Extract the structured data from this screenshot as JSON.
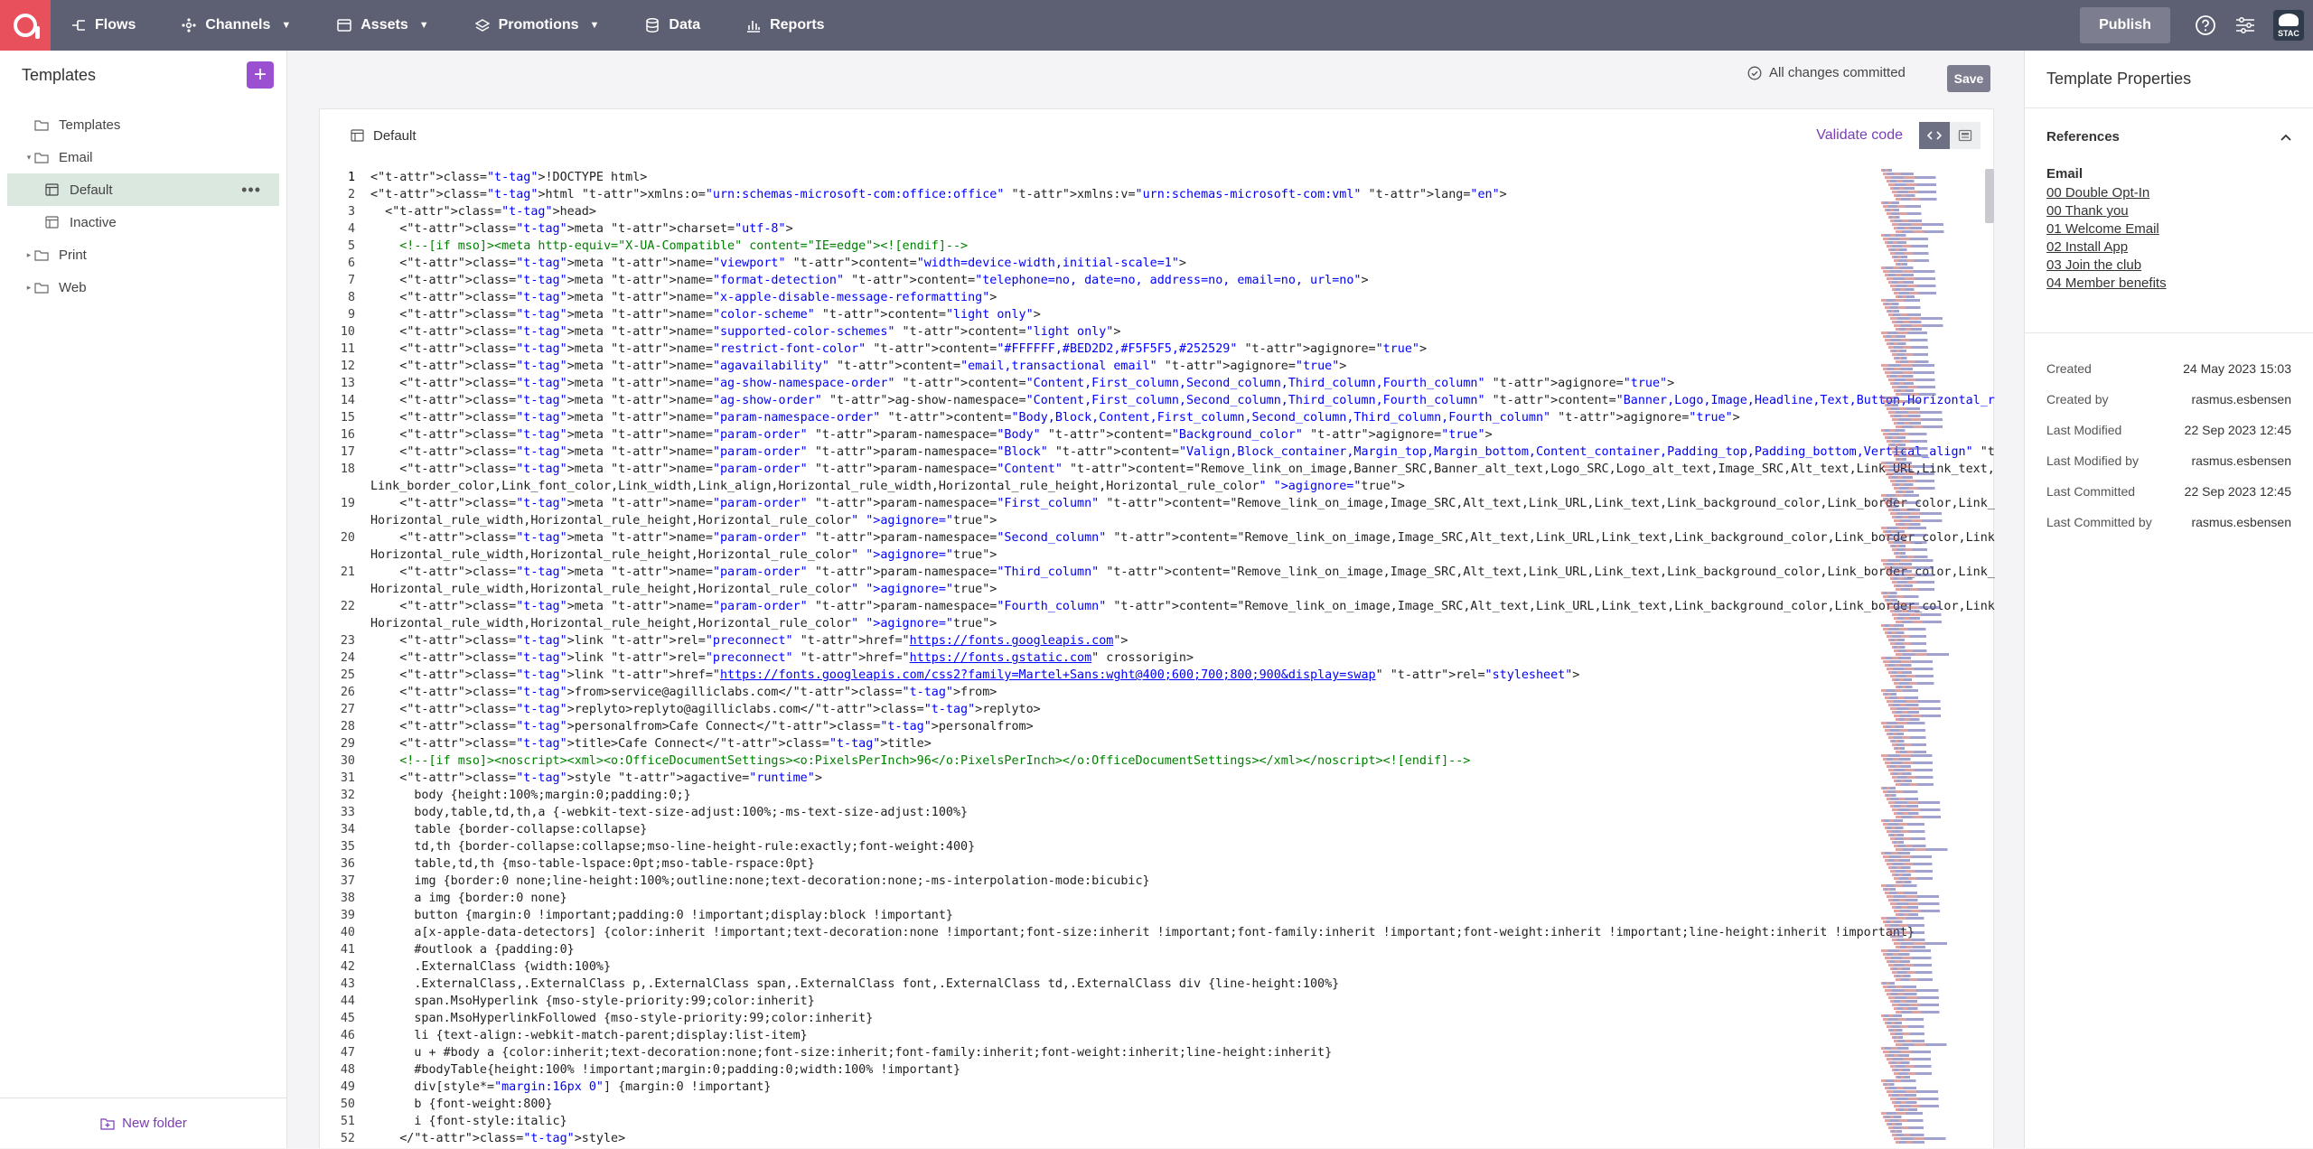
{
  "nav": {
    "items": [
      {
        "label": "Flows",
        "icon": "flows-icon",
        "has_menu": false
      },
      {
        "label": "Channels",
        "icon": "channels-icon",
        "has_menu": true
      },
      {
        "label": "Assets",
        "icon": "assets-icon",
        "has_menu": true
      },
      {
        "label": "Promotions",
        "icon": "promotions-icon",
        "has_menu": true
      },
      {
        "label": "Data",
        "icon": "database-icon",
        "has_menu": false
      },
      {
        "label": "Reports",
        "icon": "reports-icon",
        "has_menu": false
      }
    ],
    "publish_label": "Publish",
    "avatar_text": "STAC"
  },
  "sidebar": {
    "title": "Templates",
    "add_label": "+",
    "tree": [
      {
        "label": "Templates",
        "level": 0,
        "type": "folder",
        "caret": ""
      },
      {
        "label": "Email",
        "level": 0,
        "type": "folder",
        "caret": "▾"
      },
      {
        "label": "Default",
        "level": 1,
        "type": "template",
        "selected": true,
        "caret": ""
      },
      {
        "label": "Inactive",
        "level": 1,
        "type": "template",
        "caret": ""
      },
      {
        "label": "Print",
        "level": 0,
        "type": "folder",
        "caret": "▸"
      },
      {
        "label": "Web",
        "level": 0,
        "type": "folder",
        "caret": "▸"
      }
    ],
    "more_label": "•••",
    "new_folder_label": "New folder"
  },
  "status": {
    "text": "All changes committed",
    "save_label": "Save"
  },
  "editor": {
    "name": "Default",
    "validate_label": "Validate code",
    "lines": [
      {
        "n": "1",
        "code": "<!DOCTYPE html>"
      },
      {
        "n": "2",
        "code": "<html xmlns:o=\"urn:schemas-microsoft-com:office:office\" xmlns:v=\"urn:schemas-microsoft-com:vml\" lang=\"en\">"
      },
      {
        "n": "3",
        "code": "  <head>"
      },
      {
        "n": "4",
        "code": "    <meta charset=\"utf-8\">"
      },
      {
        "n": "5",
        "code": "    <!--[if mso]><meta http-equiv=\"X-UA-Compatible\" content=\"IE=edge\"><![endif]-->"
      },
      {
        "n": "6",
        "code": "    <meta name=\"viewport\" content=\"width=device-width,initial-scale=1\">"
      },
      {
        "n": "7",
        "code": "    <meta name=\"format-detection\" content=\"telephone=no, date=no, address=no, email=no, url=no\">"
      },
      {
        "n": "8",
        "code": "    <meta name=\"x-apple-disable-message-reformatting\">"
      },
      {
        "n": "9",
        "code": "    <meta name=\"color-scheme\" content=\"light only\">"
      },
      {
        "n": "10",
        "code": "    <meta name=\"supported-color-schemes\" content=\"light only\">"
      },
      {
        "n": "11",
        "code": "    <meta name=\"restrict-font-color\" content=\"#FFFFFF,#BED2D2,#F5F5F5,#252529\" agignore=\"true\">"
      },
      {
        "n": "12",
        "code": "    <meta name=\"agavailability\" content=\"email,transactional email\" agignore=\"true\">"
      },
      {
        "n": "13",
        "code": "    <meta name=\"ag-show-namespace-order\" content=\"Content,First_column,Second_column,Third_column,Fourth_column\" agignore=\"true\">"
      },
      {
        "n": "14",
        "code": "    <meta name=\"ag-show-order\" ag-show-namespace=\"Content,First_column,Second_column,Third_column,Fourth_column\" content=\"Banner,Logo,Image,Headline,Text,Button,Horizontal_rule\" agignore=\"true\">"
      },
      {
        "n": "15",
        "code": "    <meta name=\"param-namespace-order\" content=\"Body,Block,Content,First_column,Second_column,Third_column,Fourth_column\" agignore=\"true\">"
      },
      {
        "n": "16",
        "code": "    <meta name=\"param-order\" param-namespace=\"Body\" content=\"Background_color\" agignore=\"true\">"
      },
      {
        "n": "17",
        "code": "    <meta name=\"param-order\" param-namespace=\"Block\" content=\"Valign,Block_container,Margin_top,Margin_bottom,Content_container,Padding_top,Padding_bottom,Vertical_align\" agignore=\"true\">"
      },
      {
        "n": "18",
        "code": "    <meta name=\"param-order\" param-namespace=\"Content\" content=\"Remove_link_on_image,Banner_SRC,Banner_alt_text,Logo_SRC,Logo_alt_text,Image_SRC,Alt_text,Link_URL,Link_text,Link_background_color,"
      },
      {
        "n": "",
        "code": "Link_border_color,Link_font_color,Link_width,Link_align,Horizontal_rule_width,Horizontal_rule_height,Horizontal_rule_color\" agignore=\"true\">"
      },
      {
        "n": "19",
        "code": "    <meta name=\"param-order\" param-namespace=\"First_column\" content=\"Remove_link_on_image,Image_SRC,Alt_text,Link_URL,Link_text,Link_background_color,Link_border_color,Link_font_color,Link_width,Link_align,"
      },
      {
        "n": "",
        "code": "Horizontal_rule_width,Horizontal_rule_height,Horizontal_rule_color\" agignore=\"true\">"
      },
      {
        "n": "20",
        "code": "    <meta name=\"param-order\" param-namespace=\"Second_column\" content=\"Remove_link_on_image,Image_SRC,Alt_text,Link_URL,Link_text,Link_background_color,Link_border_color,Link_font_color,Link_width,Link_align,"
      },
      {
        "n": "",
        "code": "Horizontal_rule_width,Horizontal_rule_height,Horizontal_rule_color\" agignore=\"true\">"
      },
      {
        "n": "21",
        "code": "    <meta name=\"param-order\" param-namespace=\"Third_column\" content=\"Remove_link_on_image,Image_SRC,Alt_text,Link_URL,Link_text,Link_background_color,Link_border_color,Link_font_color,Link_width,Link_align,"
      },
      {
        "n": "",
        "code": "Horizontal_rule_width,Horizontal_rule_height,Horizontal_rule_color\" agignore=\"true\">"
      },
      {
        "n": "22",
        "code": "    <meta name=\"param-order\" param-namespace=\"Fourth_column\" content=\"Remove_link_on_image,Image_SRC,Alt_text,Link_URL,Link_text,Link_background_color,Link_border_color,Link_font_color,Link_width,Link_align,"
      },
      {
        "n": "",
        "code": "Horizontal_rule_width,Horizontal_rule_height,Horizontal_rule_color\" agignore=\"true\">"
      },
      {
        "n": "23",
        "code": "    <link rel=\"preconnect\" href=\"https://fonts.googleapis.com\">"
      },
      {
        "n": "24",
        "code": "    <link rel=\"preconnect\" href=\"https://fonts.gstatic.com\" crossorigin>"
      },
      {
        "n": "25",
        "code": "    <link href=\"https://fonts.googleapis.com/css2?family=Martel+Sans:wght@400;600;700;800;900&display=swap\" rel=\"stylesheet\">"
      },
      {
        "n": "26",
        "code": "    <from>service@agilliclabs.com</from>"
      },
      {
        "n": "27",
        "code": "    <replyto>replyto@agilliclabs.com</replyto>"
      },
      {
        "n": "28",
        "code": "    <personalfrom>Cafe Connect</personalfrom>"
      },
      {
        "n": "29",
        "code": "    <title>Cafe Connect</title>"
      },
      {
        "n": "30",
        "code": "    <!--[if mso]><noscript><xml><o:OfficeDocumentSettings><o:PixelsPerInch>96</o:PixelsPerInch></o:OfficeDocumentSettings></xml></noscript><![endif]-->"
      },
      {
        "n": "31",
        "code": "    <style agactive=\"runtime\">"
      },
      {
        "n": "32",
        "code": "      body {height:100%;margin:0;padding:0;}"
      },
      {
        "n": "33",
        "code": "      body,table,td,th,a {-webkit-text-size-adjust:100%;-ms-text-size-adjust:100%}"
      },
      {
        "n": "34",
        "code": "      table {border-collapse:collapse}"
      },
      {
        "n": "35",
        "code": "      td,th {border-collapse:collapse;mso-line-height-rule:exactly;font-weight:400}"
      },
      {
        "n": "36",
        "code": "      table,td,th {mso-table-lspace:0pt;mso-table-rspace:0pt}"
      },
      {
        "n": "37",
        "code": "      img {border:0 none;line-height:100%;outline:none;text-decoration:none;-ms-interpolation-mode:bicubic}"
      },
      {
        "n": "38",
        "code": "      a img {border:0 none}"
      },
      {
        "n": "39",
        "code": "      button {margin:0 !important;padding:0 !important;display:block !important}"
      },
      {
        "n": "40",
        "code": "      a[x-apple-data-detectors] {color:inherit !important;text-decoration:none !important;font-size:inherit !important;font-family:inherit !important;font-weight:inherit !important;line-height:inherit !important}"
      },
      {
        "n": "41",
        "code": "      #outlook a {padding:0}"
      },
      {
        "n": "42",
        "code": "      .ExternalClass {width:100%}"
      },
      {
        "n": "43",
        "code": "      .ExternalClass,.ExternalClass p,.ExternalClass span,.ExternalClass font,.ExternalClass td,.ExternalClass div {line-height:100%}"
      },
      {
        "n": "44",
        "code": "      span.MsoHyperlink {mso-style-priority:99;color:inherit}"
      },
      {
        "n": "45",
        "code": "      span.MsoHyperlinkFollowed {mso-style-priority:99;color:inherit}"
      },
      {
        "n": "46",
        "code": "      li {text-align:-webkit-match-parent;display:list-item}"
      },
      {
        "n": "47",
        "code": "      u + #body a {color:inherit;text-decoration:none;font-size:inherit;font-family:inherit;font-weight:inherit;line-height:inherit}"
      },
      {
        "n": "48",
        "code": "      #bodyTable{height:100% !important;margin:0;padding:0;width:100% !important}"
      },
      {
        "n": "49",
        "code": "      div[style*=\"margin:16px 0\"] {margin:0 !important}"
      },
      {
        "n": "50",
        "code": "      b {font-weight:800}"
      },
      {
        "n": "51",
        "code": "      i {font-style:italic}"
      },
      {
        "n": "52",
        "code": "    </style>"
      }
    ]
  },
  "properties": {
    "title": "Template Properties",
    "references_label": "References",
    "group_label": "Email",
    "references": [
      "00 Double Opt-In",
      "00 Thank you",
      "01 Welcome Email",
      "02 Install App",
      "03 Join the club",
      "04 Member benefits"
    ],
    "meta": [
      {
        "k": "Created",
        "v": "24 May 2023 15:03"
      },
      {
        "k": "Created by",
        "v": "rasmus.esbensen"
      },
      {
        "k": "Last Modified",
        "v": "22 Sep 2023 12:45"
      },
      {
        "k": "Last Modified by",
        "v": "rasmus.esbensen"
      },
      {
        "k": "Last Committed",
        "v": "22 Sep 2023 12:45"
      },
      {
        "k": "Last Committed by",
        "v": "rasmus.esbensen"
      }
    ]
  },
  "colors": {
    "nav_bg": "#5d5f72",
    "brand": "#e8505b",
    "accent": "#9b4fd1",
    "link": "#7b3bb5",
    "selected": "#dbe8e0"
  }
}
